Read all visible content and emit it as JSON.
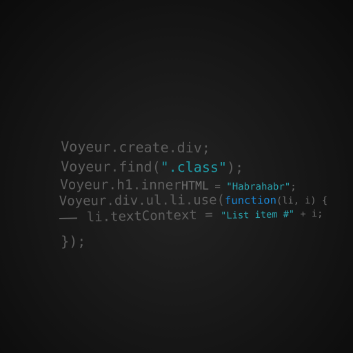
{
  "code": {
    "line1": {
      "text": "Voyeur.create.div;"
    },
    "line2": {
      "prefix": "Voyeur.find(",
      "string": "\".class\"",
      "suffix": ");"
    },
    "line3": {
      "prefix": "Voyeur.h1.inner",
      "prop": "HTML",
      "eq": " = ",
      "string": "\"Habrahabr\"",
      "suffix": ";"
    },
    "line4": {
      "prefix": "Voyeur.div.ul.li.use(",
      "keyword": "function",
      "args": "(li, i) {"
    },
    "line5": {
      "prefix": "li.textContext = ",
      "string": "\"List item #\"",
      "suffix": " + i;"
    },
    "line6": {
      "text": "});"
    }
  },
  "colors": {
    "background": "#161616",
    "code_text": "#5e5e5e",
    "string": "#1f9aa6",
    "keyword": "#1a86d6"
  }
}
